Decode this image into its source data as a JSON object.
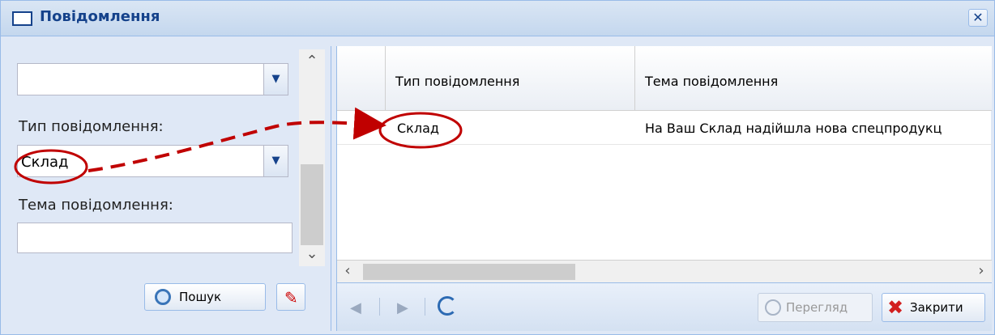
{
  "window": {
    "title": "Повідомлення",
    "close_glyph": "✕"
  },
  "filters": {
    "type_label": "Тип повідомлення:",
    "type_value": "Склад",
    "topic_label": "Тема повідомлення:",
    "topic_value": ""
  },
  "buttons": {
    "search": "Пошук",
    "view": "Перегляд",
    "close": "Закрити"
  },
  "grid": {
    "columns": [
      "",
      "Тип повідомлення",
      "Тема повідомлення"
    ],
    "rows": [
      {
        "type": "Склад",
        "topic": "На Ваш Склад надійшла нова спецпродукц"
      }
    ]
  },
  "icons": {
    "envelope": "envelope-icon",
    "search": "magnifier-icon",
    "clear": "eraser-icon",
    "refresh": "refresh-icon",
    "close": "red-x-icon"
  },
  "colors": {
    "title": "#15428b",
    "annotation": "#c00000",
    "panel_bg": "#dfe8f6"
  }
}
